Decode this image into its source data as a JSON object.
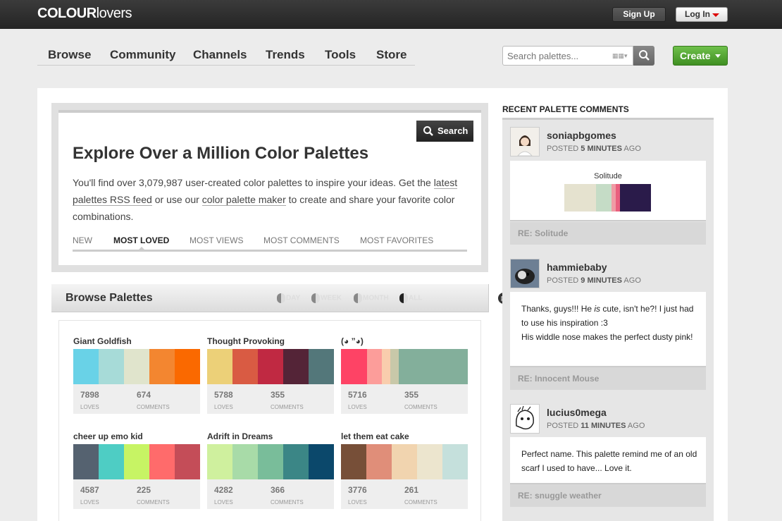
{
  "header": {
    "logo_bold": "COLOUR",
    "logo_light": "lovers",
    "signup": "Sign Up",
    "login": "Log In"
  },
  "nav": {
    "items": [
      "Browse",
      "Community",
      "Channels",
      "Trends",
      "Tools",
      "Store"
    ]
  },
  "search": {
    "placeholder": "Search palettes..."
  },
  "create_label": "Create",
  "explore": {
    "search_button": "Search",
    "title": "Explore Over a Million Color Palettes",
    "desc_1": "You'll find over 3,079,987 user-created color palettes to inspire your ideas. Get the ",
    "desc_link1": "latest palettes RSS feed",
    "desc_2": " or use our ",
    "desc_link2": "color palette maker",
    "desc_3": " to create and share your favorite color combinations.",
    "tabs": [
      "NEW",
      "MOST LOVED",
      "MOST VIEWS",
      "MOST COMMENTS",
      "MOST FAVORITES"
    ],
    "active_tab": "MOST LOVED"
  },
  "browse": {
    "title": "Browse Palettes",
    "periods": [
      "DAY",
      "WEEK",
      "MONTH",
      "ALL"
    ],
    "loves_label": "LOVES",
    "comments_label": "COMMENTS",
    "palettes": [
      {
        "title": "Giant Goldfish",
        "colors": [
          "#69D2E7",
          "#A7DBD8",
          "#E0E4CC",
          "#F38630",
          "#FA6900"
        ],
        "widths": [
          1,
          1,
          1,
          1,
          1
        ],
        "loves": "7898",
        "comments": "674"
      },
      {
        "title": "Thought Provoking",
        "colors": [
          "#ECD078",
          "#D95B43",
          "#C02942",
          "#542437",
          "#53777A"
        ],
        "widths": [
          1,
          1,
          1,
          1,
          1
        ],
        "loves": "5788",
        "comments": "355"
      },
      {
        "title": "(◕ ”◕)",
        "colors": [
          "#FE4365",
          "#FC9D9A",
          "#F9CDAD",
          "#C8C8A9",
          "#83AF9B"
        ],
        "widths": [
          1.1,
          0.6,
          0.35,
          0.35,
          2.9
        ],
        "loves": "5716",
        "comments": "355"
      },
      {
        "title": "cheer up emo kid",
        "colors": [
          "#556270",
          "#4ECDC4",
          "#C7F464",
          "#FF6B6B",
          "#C44D58"
        ],
        "widths": [
          1,
          1,
          1,
          1,
          1
        ],
        "loves": "4587",
        "comments": "225"
      },
      {
        "title": "Adrift in Dreams",
        "colors": [
          "#CFF09E",
          "#A8DBA8",
          "#79BD9A",
          "#3B8686",
          "#0B486B"
        ],
        "widths": [
          1,
          1,
          1,
          1,
          1
        ],
        "loves": "4282",
        "comments": "366"
      },
      {
        "title": "let them eat cake",
        "colors": [
          "#774F38",
          "#E08E79",
          "#F1D4AF",
          "#ECE5CE",
          "#C5E0DC"
        ],
        "widths": [
          1,
          1,
          1,
          1,
          1
        ],
        "loves": "3776",
        "comments": "261"
      }
    ]
  },
  "sidebar": {
    "title": "RECENT PALETTE COMMENTS",
    "comments": [
      {
        "user": "soniapbgomes",
        "posted_pre": "POSTED ",
        "posted_num": "5 MINUTES",
        "posted_post": " AGO",
        "palette_name": "Solitude",
        "palette_colors": [
          "#E5E2CF",
          "#C5DCC6",
          "#F09BA5",
          "#E95F7E",
          "#2A1B4A"
        ],
        "palette_widths": [
          3.8,
          1.9,
          0.5,
          0.5,
          3.7
        ],
        "re": "RE: Solitude"
      },
      {
        "user": "hammiebaby",
        "posted_pre": "POSTED ",
        "posted_num": "9 MINUTES",
        "posted_post": " AGO",
        "text_1": "Thanks, guys!!! He ",
        "text_em": "is",
        "text_2": " cute, isn't he?! I just had to use his inspiration :3",
        "text_3": "His widdle nose makes the perfect dusty pink!",
        "re": "RE: Innocent Mouse"
      },
      {
        "user": "lucius0mega",
        "posted_pre": "POSTED ",
        "posted_num": "11 MINUTES",
        "posted_post": " AGO",
        "text_1": "Perfect name. This palette remind me of an old scarf I used to have... Love it.",
        "re": "RE: snuggle weather"
      }
    ]
  }
}
